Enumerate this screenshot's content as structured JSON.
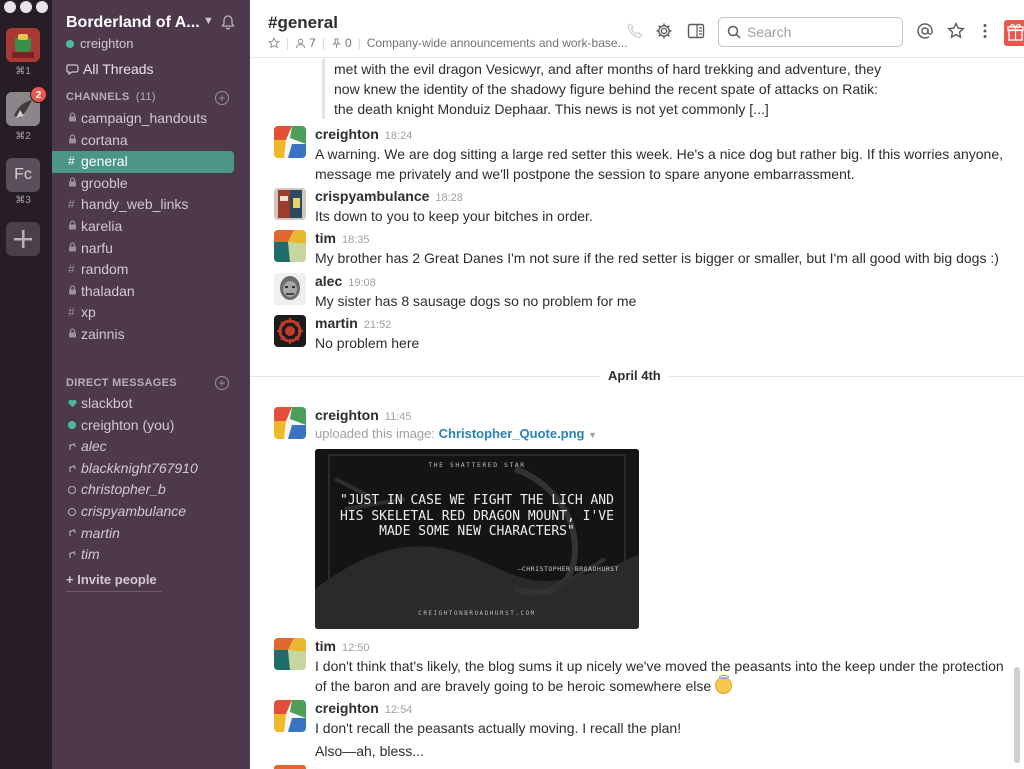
{
  "teams": [
    {
      "shortcut": "⌘1"
    },
    {
      "shortcut": "⌘2",
      "badge": "2"
    },
    {
      "initials": "Fc",
      "shortcut": "⌘3"
    }
  ],
  "sidebar": {
    "team_name": "Borderland of A...",
    "user": "creighton",
    "all_threads": "All Threads",
    "channels_title": "CHANNELS",
    "channels_count": "(11)",
    "channels": [
      {
        "name": "campaign_handouts",
        "type": "private"
      },
      {
        "name": "cortana",
        "type": "private"
      },
      {
        "name": "general",
        "type": "public",
        "active": true
      },
      {
        "name": "grooble",
        "type": "private"
      },
      {
        "name": "handy_web_links",
        "type": "public"
      },
      {
        "name": "karelia",
        "type": "private"
      },
      {
        "name": "narfu",
        "type": "private"
      },
      {
        "name": "random",
        "type": "public"
      },
      {
        "name": "thaladan",
        "type": "private"
      },
      {
        "name": "xp",
        "type": "public"
      },
      {
        "name": "zainnis",
        "type": "private"
      }
    ],
    "dm_title": "DIRECT MESSAGES",
    "dms": [
      {
        "name": "slackbot",
        "status": "heart"
      },
      {
        "name": "creighton (you)",
        "status": "online"
      },
      {
        "name": "alec",
        "status": "away"
      },
      {
        "name": "blackknight767910",
        "status": "away"
      },
      {
        "name": "christopher_b",
        "status": "offline"
      },
      {
        "name": "crispyambulance",
        "status": "offline"
      },
      {
        "name": "martin",
        "status": "away"
      },
      {
        "name": "tim",
        "status": "away"
      }
    ],
    "invite": "+ Invite people"
  },
  "header": {
    "channel": "#general",
    "members": "7",
    "pins": "0",
    "topic": "Company-wide announcements and work-base...",
    "search_placeholder": "Search"
  },
  "quoted_text": "met with the evil dragon Vesicwyr, and after months of hard trekking and adventure, they now knew the identity of the shadowy figure behind the recent spate of attacks on Ratik: the death knight Monduiz Dephaar. This news is not yet commonly [...]",
  "messages": [
    {
      "author": "creighton",
      "time": "18:24",
      "text": "A warning. We are dog sitting a large red setter this week. He's a nice dog but rather big. If this worries anyone, message me privately and we'll postpone the session to spare anyone embarrassment."
    },
    {
      "author": "crispyambulance",
      "time": "18:28",
      "text": "Its down to you to keep your bitches in order."
    },
    {
      "author": "tim",
      "time": "18:35",
      "text": "My brother has 2 Great Danes I'm not sure if the red setter is bigger or smaller, but I'm all good with big dogs :)"
    },
    {
      "author": "alec",
      "time": "19:08",
      "text": "My sister has 8 sausage dogs so no problem for me"
    },
    {
      "author": "martin",
      "time": "21:52",
      "text": "No problem here"
    }
  ],
  "date_divider": "April 4th",
  "upload": {
    "author": "creighton",
    "time": "11:45",
    "prefix": "uploaded this image:",
    "filename": "Christopher_Quote.png",
    "image_tag": "THE SHATTERED STAR",
    "image_quote": "\"JUST IN CASE WE FIGHT THE LICH AND HIS SKELETAL RED DRAGON MOUNT, I'VE MADE SOME NEW CHARACTERS\"",
    "image_attrib": "—CHRISTOPHER BROADHURST",
    "image_site": "CREIGHTONBROADHURST.COM"
  },
  "later_messages": [
    {
      "author": "tim",
      "time": "12:50",
      "text": "I don't think that's likely, the blog sums it up nicely we've moved the peasants into the keep under the protection of the baron and are bravely going to be heroic somewhere else"
    },
    {
      "author": "creighton",
      "time": "12:54",
      "text": "I don't recall the peasants actually moving. I recall the plan!",
      "text2": "Also—ah, bless..."
    }
  ],
  "colors": {
    "sidebar": "#4d394b",
    "active": "#4c9689",
    "switcher": "#261d26",
    "online": "#4fb99f",
    "link": "#2a80b9"
  }
}
